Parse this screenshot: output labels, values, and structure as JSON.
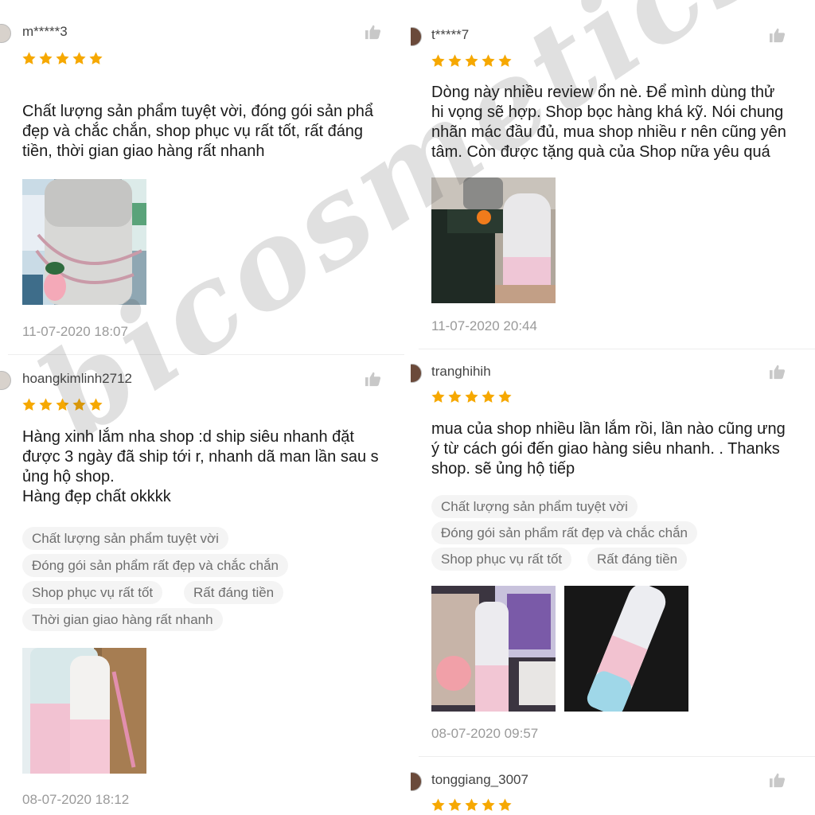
{
  "reviews": {
    "r1": {
      "username": "m*****3",
      "rating": 5,
      "lines": [
        " Chất lượng sản phẩm tuyệt vời, đóng gói sản phẩ",
        "đẹp và chắc chắn, shop phục vụ rất tốt, rất đáng",
        "tiền, thời gian giao hàng rất nhanh"
      ],
      "date": "11-07-2020 18:07"
    },
    "r2": {
      "username": "hoangkimlinh2712",
      "rating": 5,
      "lines": [
        "Hàng xinh lắm nha shop :d ship siêu nhanh đặt",
        "được 3 ngày đã ship tới r, nhanh dã man lần sau s",
        "ủng hộ shop.",
        "Hàng đẹp chất okkkk"
      ],
      "tags": [
        "Chất lượng sản phẩm tuyệt vời",
        "Đóng gói sản phẩm rất đẹp và chắc chắn",
        "Shop phục vụ rất tốt",
        "Rất đáng tiền",
        "Thời gian giao hàng rất nhanh"
      ],
      "date": "08-07-2020 18:12"
    },
    "r3": {
      "username": "t*****7",
      "rating": 5,
      "lines": [
        "Dòng này nhiều review ổn nè. Để mình dùng thử",
        "hi vọng sẽ hợp. Shop bọc hàng khá kỹ. Nói chung",
        "nhãn mác đầu đủ, mua shop nhiều r nên  cũng yên",
        "tâm. Còn được tặng quà của Shop nữa yêu quá"
      ],
      "date": "11-07-2020 20:44"
    },
    "r4": {
      "username": "tranghihih",
      "rating": 5,
      "lines": [
        "mua của shop nhiều lần lắm rồi, lần nào cũng ưng",
        "ý từ cách gói đến giao hàng siêu nhanh. . Thanks",
        "shop. sẽ ủng hộ tiếp"
      ],
      "tags": [
        "Chất lượng sản phẩm tuyệt vời",
        "Đóng gói sản phẩm rất đẹp và chắc chắn",
        "Shop phục vụ rất tốt",
        "Rất đáng tiền"
      ],
      "date": "08-07-2020 09:57"
    },
    "r5": {
      "username": "tonggiang_3007",
      "rating": 5
    }
  },
  "icons": {
    "like": "thumbs-up-icon",
    "star": "star-icon"
  },
  "colors": {
    "star": "#f6a800",
    "tag_bg": "#f4f4f4",
    "muted": "#9a9a9a"
  }
}
